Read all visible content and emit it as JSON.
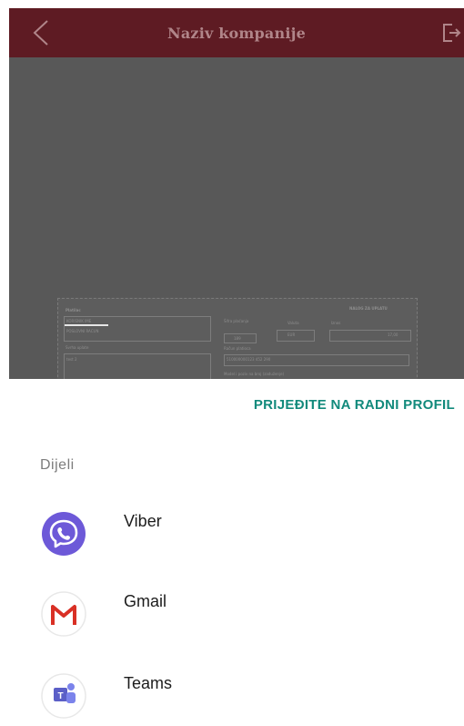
{
  "header": {
    "title": "Naziv kompanije",
    "back_icon": "chevron-left-icon",
    "logout_icon": "logout-icon",
    "bar_color": "#5e1b23"
  },
  "document_preview": {
    "form_title": "NALOG ZA UPLATU",
    "payer_label": "Platilac",
    "payer_line1": "KORISNIK IME",
    "payer_line2": "POSLOVNI RACUN",
    "purpose_label": "Svrha uplate",
    "purpose_value": "test 2",
    "code_label": "Šifra plaćanja",
    "code_value": "189",
    "currency_label": "Valuta",
    "currency_value": "EUR",
    "amount_label": "Iznos",
    "amount_value": "17,00",
    "account_label": "Račun platioca",
    "account_value": "510000000123 452 290",
    "model_label": "Model i poziv na broj (zaduženje)"
  },
  "sheet": {
    "work_profile_link": "PRIJEĐITE NA RADNI PROFIL",
    "share_title": "Dijeli",
    "accent_color": "#128a7c",
    "apps": [
      {
        "label": "Viber",
        "icon": "viber-icon"
      },
      {
        "label": "Gmail",
        "icon": "gmail-icon"
      },
      {
        "label": "Teams",
        "icon": "teams-icon"
      }
    ]
  }
}
